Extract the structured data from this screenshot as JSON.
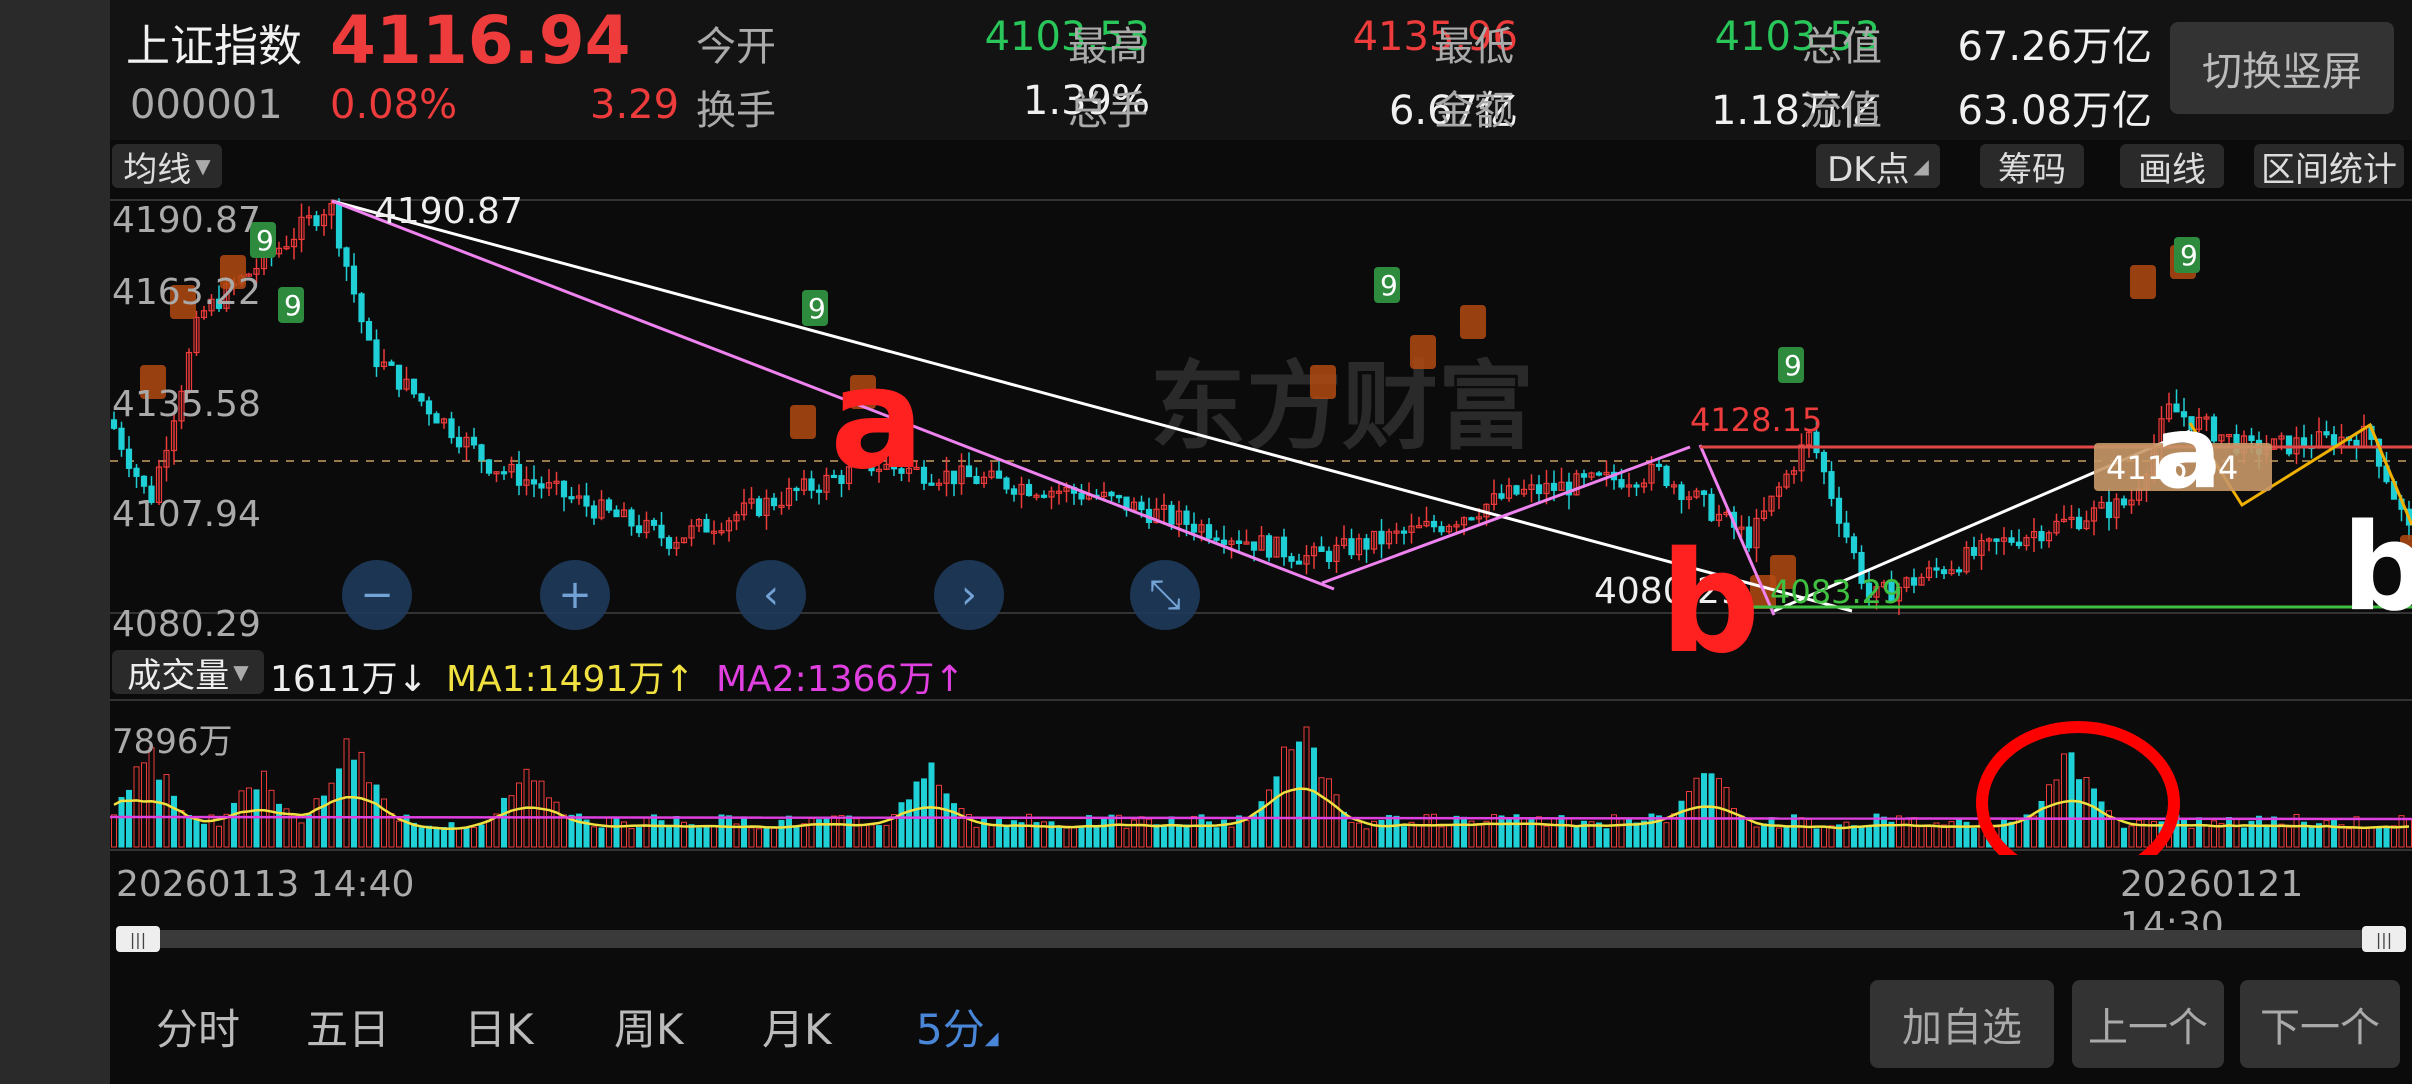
{
  "header": {
    "index_name": "上证指数",
    "price": "4116.94",
    "code": "000001",
    "change_pct": "0.08%",
    "change_abs": "3.29",
    "stats": [
      {
        "label": "今开",
        "value": "4103.53",
        "color": "#29c65a"
      },
      {
        "label": "最高",
        "value": "4135.96",
        "color": "#ee3b3b"
      },
      {
        "label": "最低",
        "value": "4103.53",
        "color": "#29c65a"
      },
      {
        "label": "总值",
        "value": "67.26万亿",
        "color": "#f0f0f0"
      },
      {
        "label": "换手",
        "value": "1.39%",
        "color": "#f0f0f0"
      },
      {
        "label": "总手",
        "value": "6.67亿",
        "color": "#f0f0f0"
      },
      {
        "label": "金额",
        "value": "1.18万亿",
        "color": "#f0f0f0"
      },
      {
        "label": "流值",
        "value": "63.08万亿",
        "color": "#f0f0f0"
      }
    ],
    "switch_label": "切换竖屏"
  },
  "toolbar": {
    "ma_label": "均线",
    "dk_label": "DK点",
    "chip_label": "筹码",
    "draw_label": "画线",
    "stats_label": "区间统计"
  },
  "chart": {
    "y_ticks": [
      "4190.87",
      "4163.22",
      "4135.58",
      "4107.94",
      "4080.29"
    ],
    "high_label": "4190.87",
    "low_label": "4080.29",
    "mid_high_label": "4128.15",
    "mid_low_label": "4083.29",
    "cur_price_label": "4116.94",
    "watermark": "东方财富",
    "annotations": [
      "a",
      "b",
      "a",
      "b"
    ],
    "nav_buttons": [
      "−",
      "+",
      "‹",
      "›",
      "⤡"
    ]
  },
  "volume": {
    "label": "成交量",
    "current": "1611万",
    "ma1": "MA1:1491万",
    "ma2": "MA2:1366万",
    "ma1_arrow": "↑",
    "ma2_arrow": "↑",
    "cur_arrow": "↓",
    "max_tick": "7896万"
  },
  "dates": {
    "start": "20260113 14:40",
    "end": "20260121 14:30"
  },
  "tabs": [
    {
      "label": "分时"
    },
    {
      "label": "五日"
    },
    {
      "label": "日K"
    },
    {
      "label": "周K"
    },
    {
      "label": "月K"
    },
    {
      "label": "5分"
    }
  ],
  "actions": {
    "add_watch": "加自选",
    "prev": "上一个",
    "next": "下一个"
  },
  "colors": {
    "up": "#ee3b3b",
    "down": "#29c65a",
    "candle_down": "#1fd0d6",
    "ma1": "#f0e040",
    "ma2": "#e040e0",
    "accent": "#4a86d8"
  }
}
